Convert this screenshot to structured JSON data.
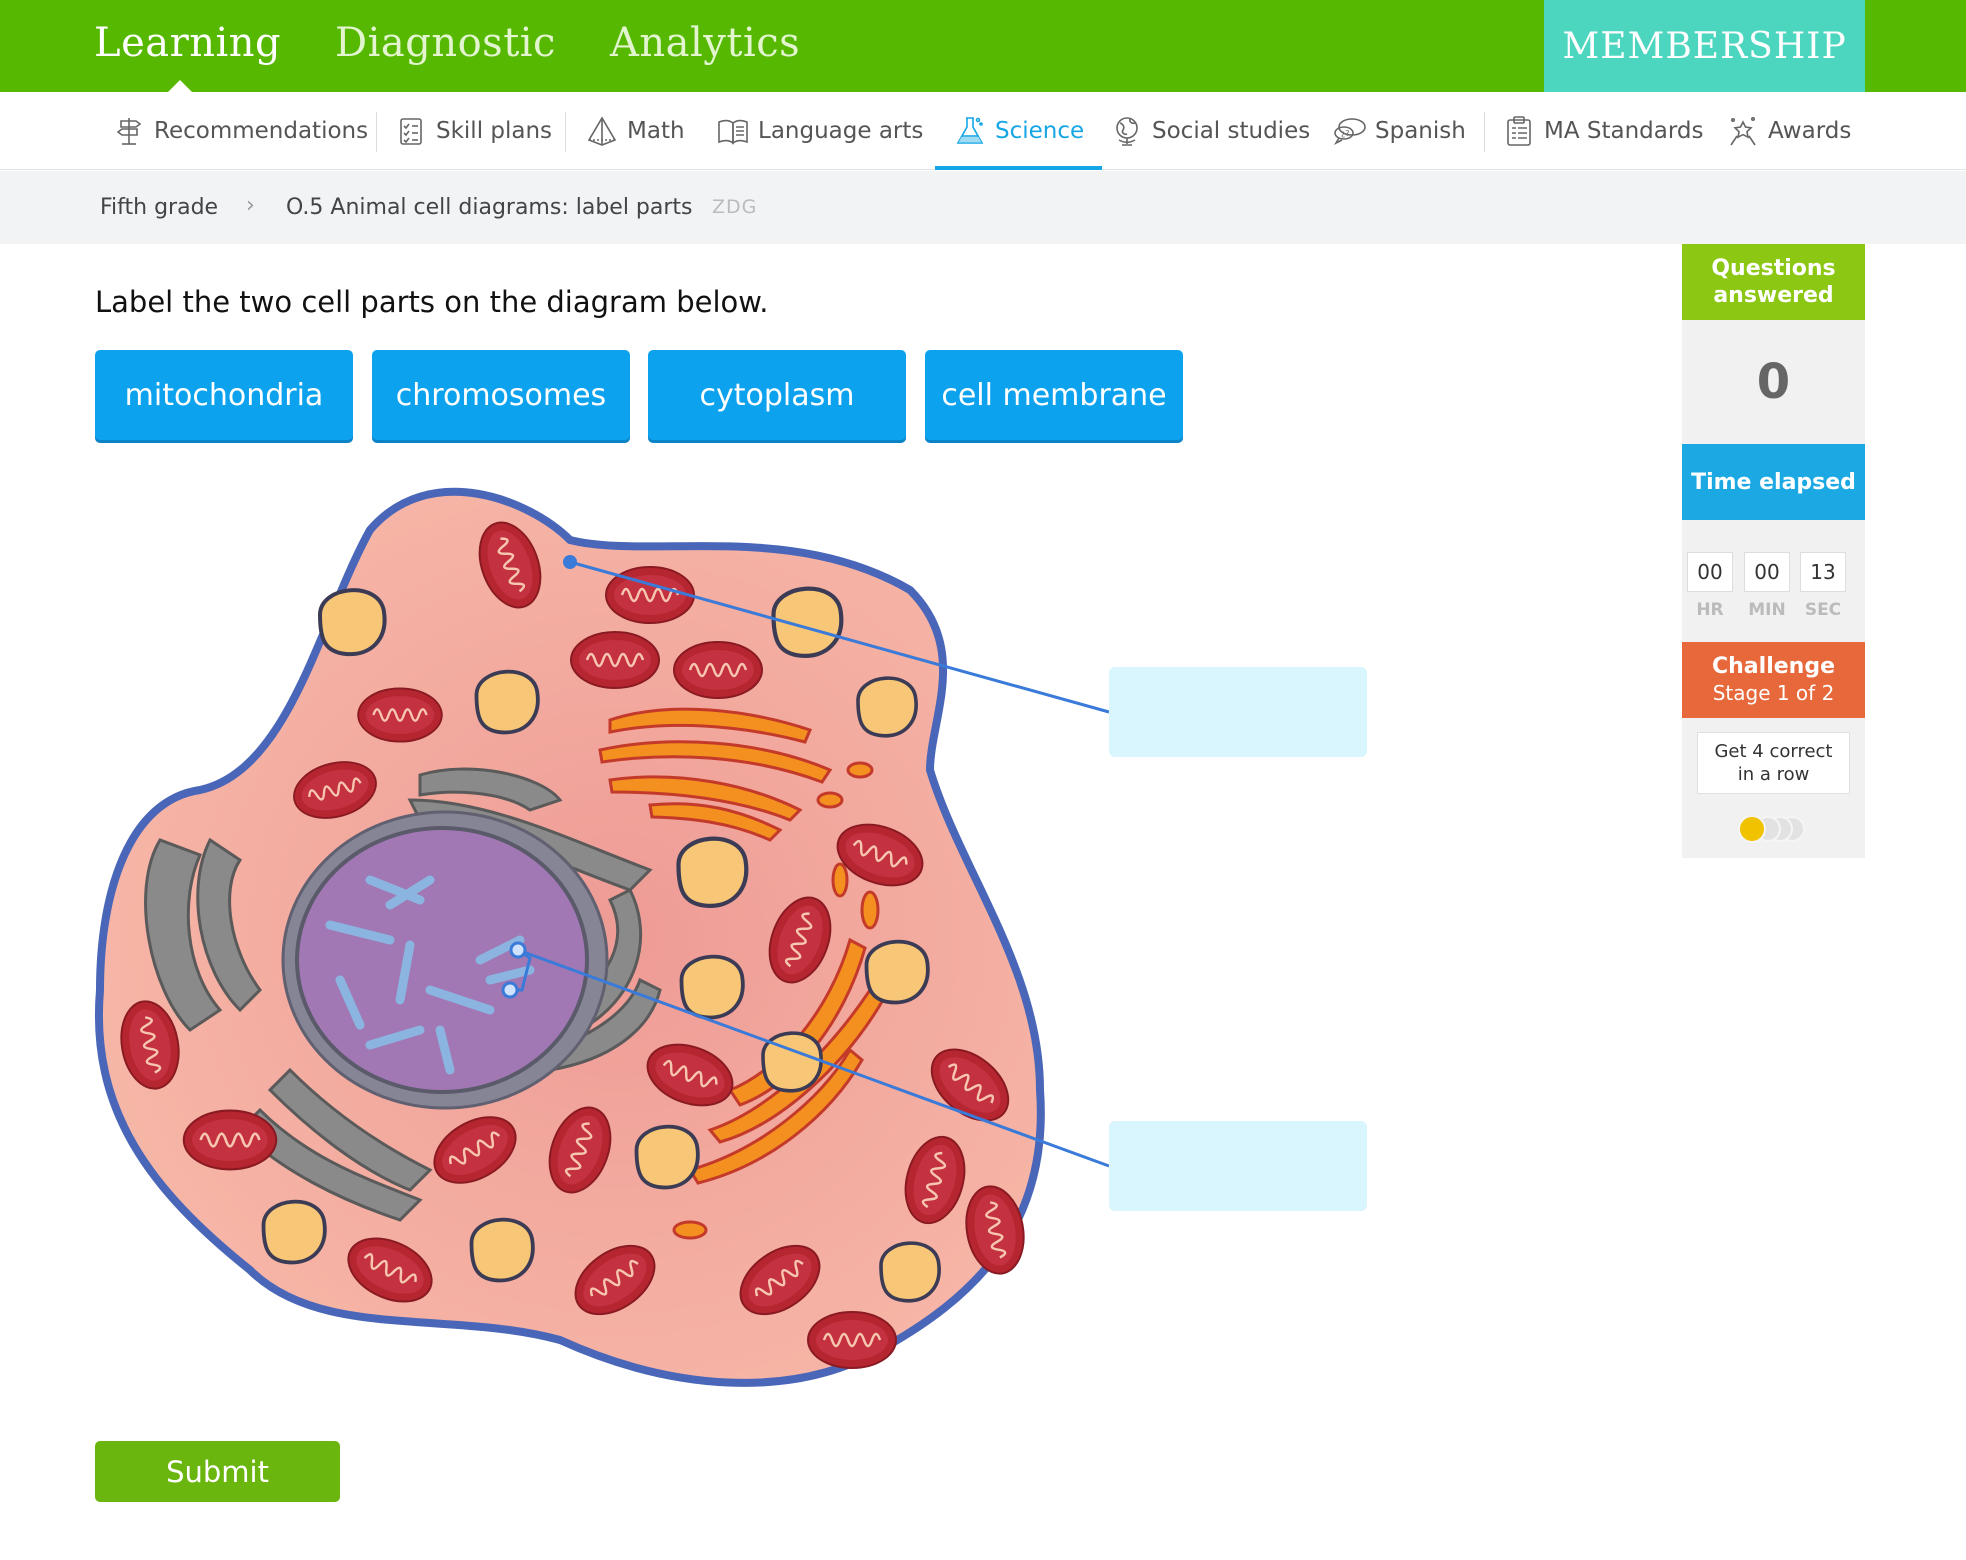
{
  "topnav": {
    "tabs": [
      {
        "label": "Learning"
      },
      {
        "label": "Diagnostic"
      },
      {
        "label": "Analytics"
      }
    ],
    "membership_label": "MEMBERSHIP"
  },
  "subnav": {
    "items": [
      {
        "label": "Recommendations",
        "icon": "signpost-icon"
      },
      {
        "label": "Skill plans",
        "icon": "checklist-icon"
      },
      {
        "label": "Math",
        "icon": "pyramid-icon"
      },
      {
        "label": "Language arts",
        "icon": "book-icon"
      },
      {
        "label": "Science",
        "icon": "flask-icon",
        "active": true
      },
      {
        "label": "Social studies",
        "icon": "globe-icon"
      },
      {
        "label": "Spanish",
        "icon": "speech-bubbles-icon"
      },
      {
        "label": "MA Standards",
        "icon": "clipboard-icon"
      },
      {
        "label": "Awards",
        "icon": "award-icon"
      }
    ]
  },
  "breadcrumb": {
    "grade": "Fifth grade",
    "skill": "O.5 Animal cell diagrams: label parts",
    "code": "ZDG"
  },
  "question": {
    "prompt": "Label the two cell parts on the diagram below.",
    "choices": [
      "mitochondria",
      "chromosomes",
      "cytoplasm",
      "cell membrane"
    ],
    "submit_label": "Submit"
  },
  "sidebar": {
    "questions_answered_label": "Questions answered",
    "questions_answered_value": "0",
    "time_elapsed_label": "Time elapsed",
    "timer": {
      "hr": "00",
      "min": "00",
      "sec": "13"
    },
    "timer_labels": {
      "hr": "HR",
      "min": "MIN",
      "sec": "SEC"
    },
    "challenge_title": "Challenge",
    "challenge_stage": "Stage 1 of 2",
    "challenge_goal": "Get 4 correct in a row"
  },
  "colors": {
    "brand_green": "#56b800",
    "membership_teal": "#4dd6bf",
    "science_blue": "#16a6e6",
    "choice_blue": "#0da2ee",
    "submit_green": "#6ab60f",
    "challenge_orange": "#e7683a"
  }
}
